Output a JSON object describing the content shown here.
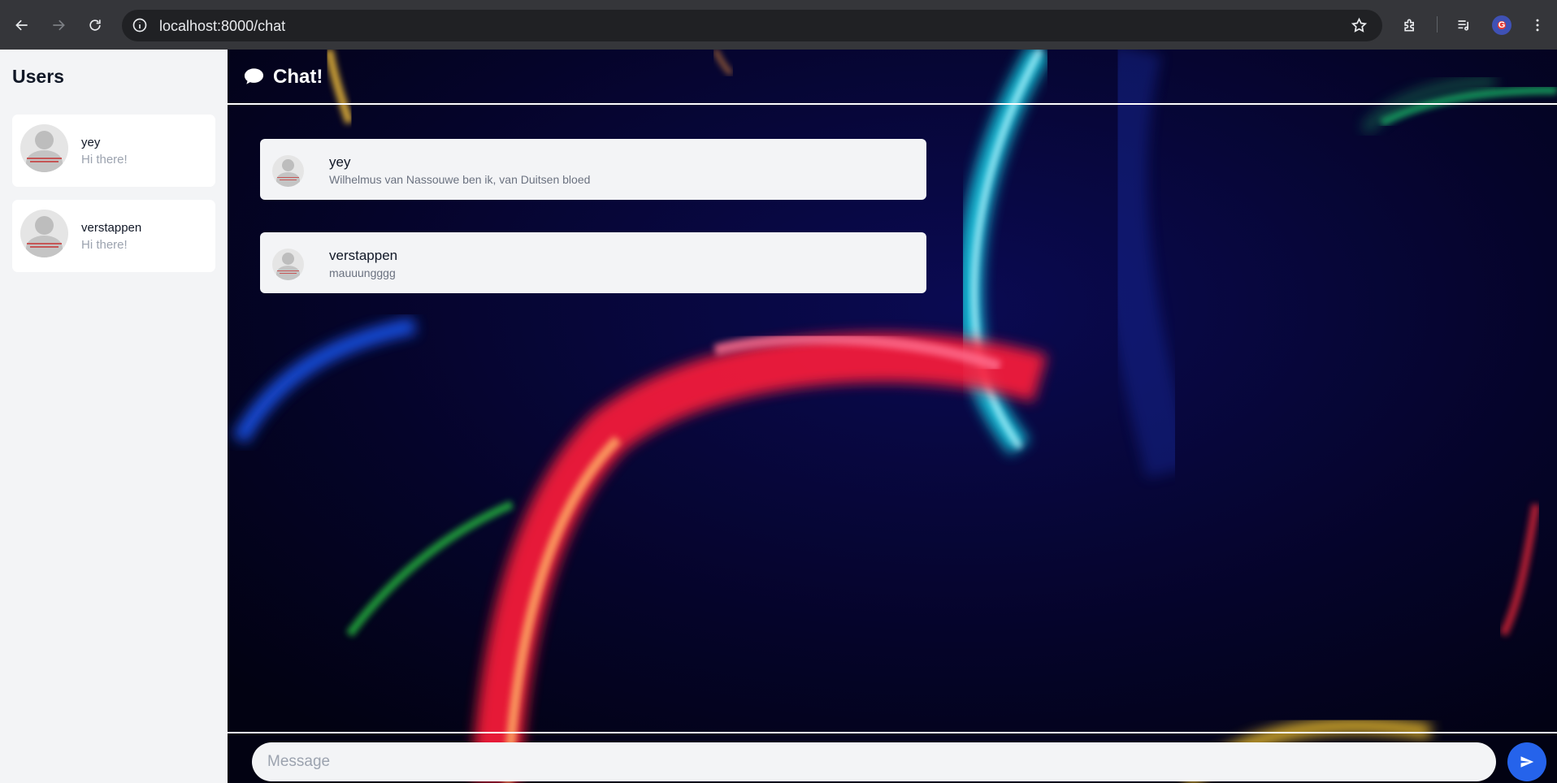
{
  "browser": {
    "url": "localhost:8000/chat",
    "icons": [
      "back-arrow-icon",
      "forward-arrow-icon",
      "reload-icon",
      "site-info-icon",
      "bookmark-star-icon",
      "extensions-icon",
      "media-controls-icon",
      "profile-avatar",
      "more-menu-icon"
    ],
    "profile_initial": "G"
  },
  "sidebar": {
    "title": "Users",
    "users": [
      {
        "name": "yey",
        "preview": "Hi there!"
      },
      {
        "name": "verstappen",
        "preview": "Hi there!"
      }
    ]
  },
  "chat": {
    "title": "Chat!",
    "icon": "chat-bubble-icon",
    "messages": [
      {
        "sender": "yey",
        "text": "Wilhelmus van Nassouwe ben ik, van Duitsen bloed"
      },
      {
        "sender": "verstappen",
        "text": "mauuungggg"
      }
    ],
    "input_placeholder": "Message",
    "send_icon": "send-arrow-icon"
  },
  "colors": {
    "chrome_bar": "#35363a",
    "sidebar_bg": "#f3f4f6",
    "send_button": "#2563eb",
    "chat_background": "#04031f"
  }
}
